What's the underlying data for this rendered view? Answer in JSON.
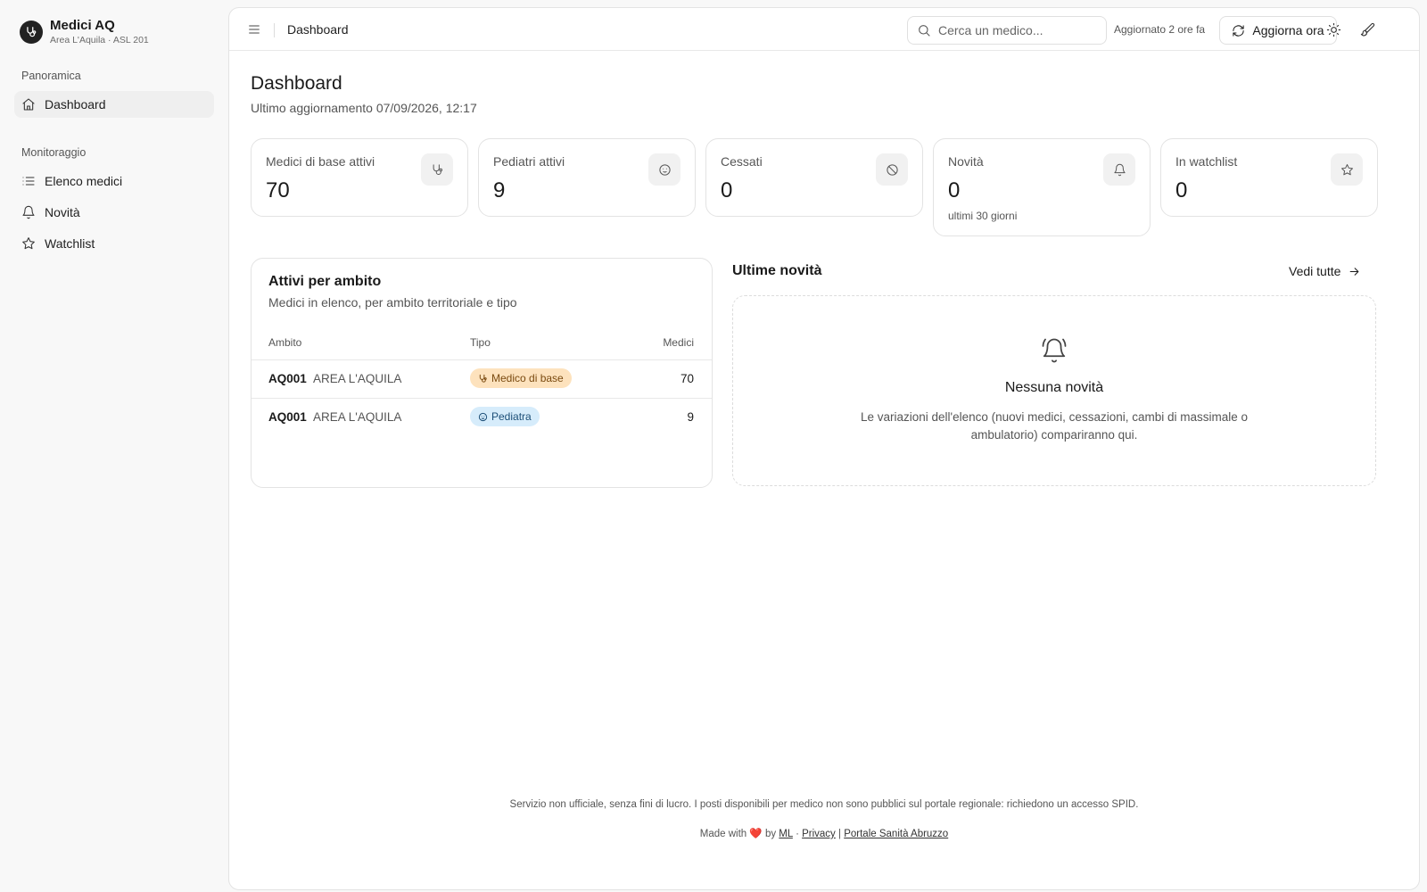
{
  "brand": {
    "title": "Medici AQ",
    "subtitle": "Area L'Aquila · ASL 201"
  },
  "sidebar": {
    "groups": [
      {
        "label": "Panoramica",
        "items": [
          {
            "label": "Dashboard",
            "icon": "home-icon",
            "active": true
          }
        ]
      },
      {
        "label": "Monitoraggio",
        "items": [
          {
            "label": "Elenco medici",
            "icon": "list-icon"
          },
          {
            "label": "Novità",
            "icon": "bell-icon"
          },
          {
            "label": "Watchlist",
            "icon": "star-icon"
          }
        ]
      }
    ]
  },
  "topbar": {
    "breadcrumb": "Dashboard",
    "search_placeholder": "Cerca un medico...",
    "updated": "Aggiornato 2 ore fa",
    "refresh_label": "Aggiorna ora"
  },
  "page": {
    "title": "Dashboard",
    "subtitle": "Ultimo aggiornamento 07/09/2026, 12:17"
  },
  "stats": [
    {
      "label": "Medici di base attivi",
      "value": "70",
      "icon": "stethoscope-icon"
    },
    {
      "label": "Pediatri attivi",
      "value": "9",
      "icon": "baby-icon"
    },
    {
      "label": "Cessati",
      "value": "0",
      "icon": "ban-icon"
    },
    {
      "label": "Novità",
      "value": "0",
      "note": "ultimi 30 giorni",
      "icon": "bell-icon"
    },
    {
      "label": "In watchlist",
      "value": "0",
      "icon": "star-icon"
    }
  ],
  "ambito_table": {
    "title": "Attivi per ambito",
    "subtitle": "Medici in elenco, per ambito territoriale e tipo",
    "columns": [
      "Ambito",
      "Tipo",
      "Medici"
    ],
    "rows": [
      {
        "code": "AQ001",
        "area": "AREA L'AQUILA",
        "tipo": "Medico di base",
        "count": "70"
      },
      {
        "code": "AQ001",
        "area": "AREA L'AQUILA",
        "tipo": "Pediatra",
        "count": "9"
      }
    ]
  },
  "news": {
    "title": "Ultime novità",
    "link": "Vedi tutte",
    "empty_title": "Nessuna novità",
    "empty_text": "Le variazioni dell'elenco (nuovi medici, cessazioni, cambi di massimale o ambulatorio) compariranno qui."
  },
  "footer": {
    "note": "Servizio non ufficiale, senza fini di lucro. I posti disponibili per medico non sono pubblici sul portale regionale: richiedono un accesso SPID.",
    "made_with": "Made with",
    "heart": "❤️",
    "by": "by",
    "author": "ML",
    "sep1": "·",
    "privacy": "Privacy",
    "sep2": "|",
    "portal": "Portale Sanità Abruzzo"
  },
  "colors": {
    "accent_dark": "#222222",
    "badge_medico_bg": "#fde2bd",
    "badge_pediatra_bg": "#d6ecfb"
  }
}
